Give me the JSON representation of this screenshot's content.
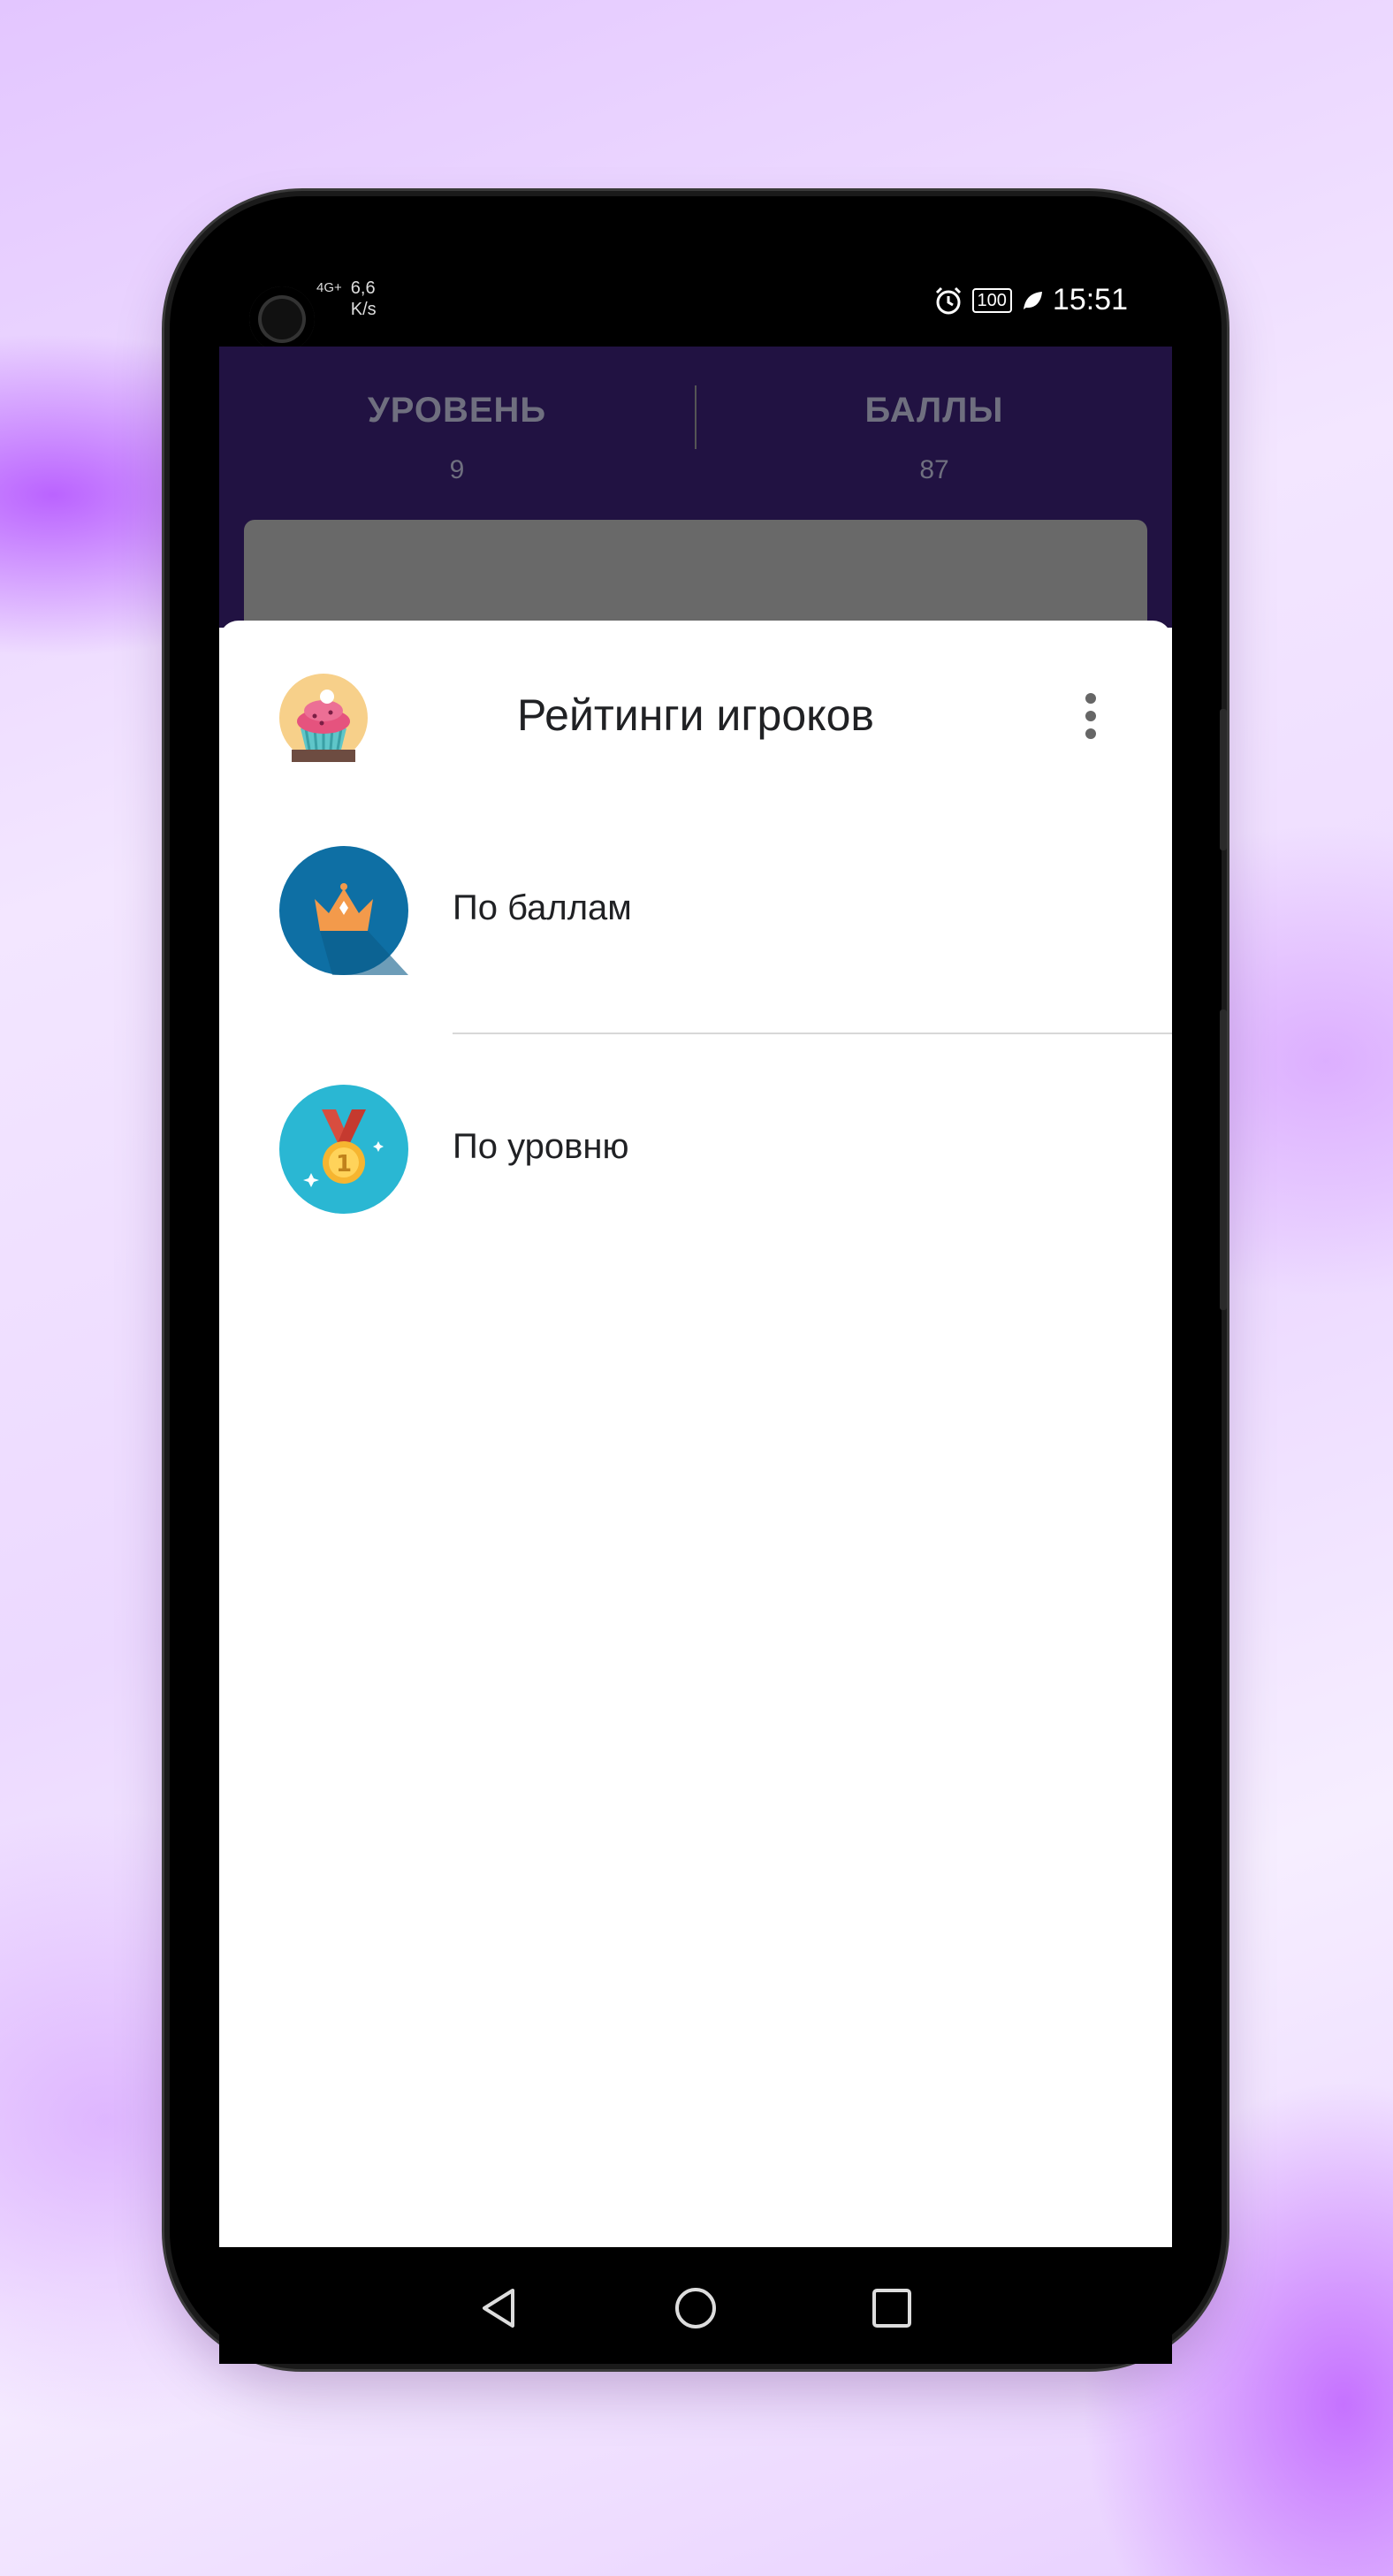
{
  "status_bar": {
    "network": "4G+",
    "speed": "6,6",
    "speed_unit": "K/s",
    "battery": "100",
    "time": "15:51",
    "icons": [
      "alarm-icon",
      "battery-icon",
      "leaf-icon"
    ]
  },
  "game_header": {
    "level_label": "УРОВЕНЬ",
    "level_value": "9",
    "score_label": "БАЛЛЫ",
    "score_value": "87"
  },
  "sheet": {
    "title": "Рейтинги игроков",
    "app_icon": "cupcake-icon",
    "menu_icon": "more-vert-icon",
    "items": [
      {
        "label": "По баллам",
        "icon": "crown-icon"
      },
      {
        "label": "По уровню",
        "icon": "medal-icon"
      }
    ]
  },
  "navbar": {
    "icons": [
      "back-icon",
      "home-icon",
      "recents-icon"
    ]
  },
  "colors": {
    "header_bg": "#211242",
    "crown_bg": "#0e6fa4",
    "medal_bg": "#2ab7d3"
  }
}
